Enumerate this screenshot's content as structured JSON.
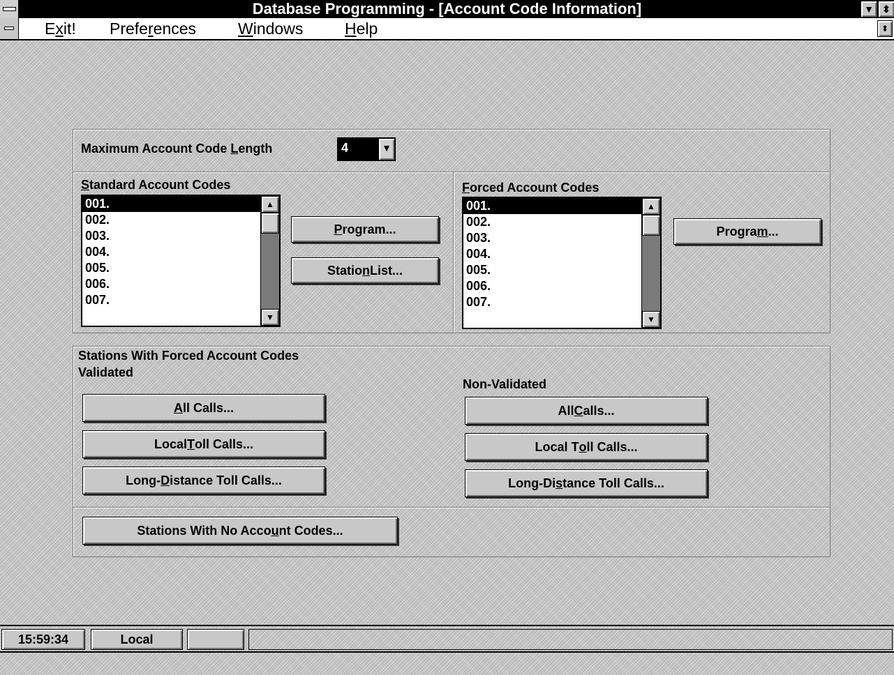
{
  "window": {
    "title": "Database Programming - [Account Code Information]",
    "sys_menu_icon": "system-menu-icon",
    "minimize_icon": "minimize-arrow-icon",
    "restore_icon": "restore-arrows-icon"
  },
  "menu": {
    "items": [
      {
        "pre": "E",
        "mn": "x",
        "post": "it!"
      },
      {
        "pre": "Prefe",
        "mn": "r",
        "post": "ences"
      },
      {
        "pre": "",
        "mn": "W",
        "post": "indows"
      },
      {
        "pre": "",
        "mn": "H",
        "post": "elp"
      }
    ]
  },
  "max_length": {
    "label_pre": "Maximum Account Code ",
    "label_mn": "L",
    "label_post": "ength",
    "value": "4"
  },
  "standard": {
    "header_mn": "S",
    "header_post": "tandard Account Codes",
    "items": [
      "001.",
      "002.",
      "003.",
      "004.",
      "005.",
      "006.",
      "007."
    ],
    "selected_index": 0,
    "program": {
      "pre": "",
      "mn": "P",
      "post": "rogram..."
    },
    "station_list": {
      "pre": "Statio",
      "mn": "n",
      "post": " List..."
    }
  },
  "forced": {
    "header_mn": "F",
    "header_post": "orced Account Codes",
    "items": [
      "001.",
      "002.",
      "003.",
      "004.",
      "005.",
      "006.",
      "007."
    ],
    "selected_index": 0,
    "program": {
      "pre": "Progra",
      "mn": "m",
      "post": "..."
    }
  },
  "stations_forced": {
    "title": "Stations With Forced Account Codes",
    "validated_label": "Validated",
    "nonvalidated_label": "Non-Validated",
    "validated_buttons": [
      {
        "pre": "",
        "mn": "A",
        "post": "ll Calls..."
      },
      {
        "pre": "Local ",
        "mn": "T",
        "post": "oll Calls..."
      },
      {
        "pre": "Long-",
        "mn": "D",
        "post": "istance Toll Calls..."
      }
    ],
    "nonvalidated_buttons": [
      {
        "pre": "All ",
        "mn": "C",
        "post": "alls..."
      },
      {
        "pre": "Local T",
        "mn": "o",
        "post": "ll Calls..."
      },
      {
        "pre": "Long-Di",
        "mn": "s",
        "post": "tance Toll Calls..."
      }
    ]
  },
  "no_codes": {
    "pre": "Stations With No Acco",
    "mn": "u",
    "post": "nt Codes..."
  },
  "status": {
    "time": "15:59:34",
    "mode": "Local"
  }
}
